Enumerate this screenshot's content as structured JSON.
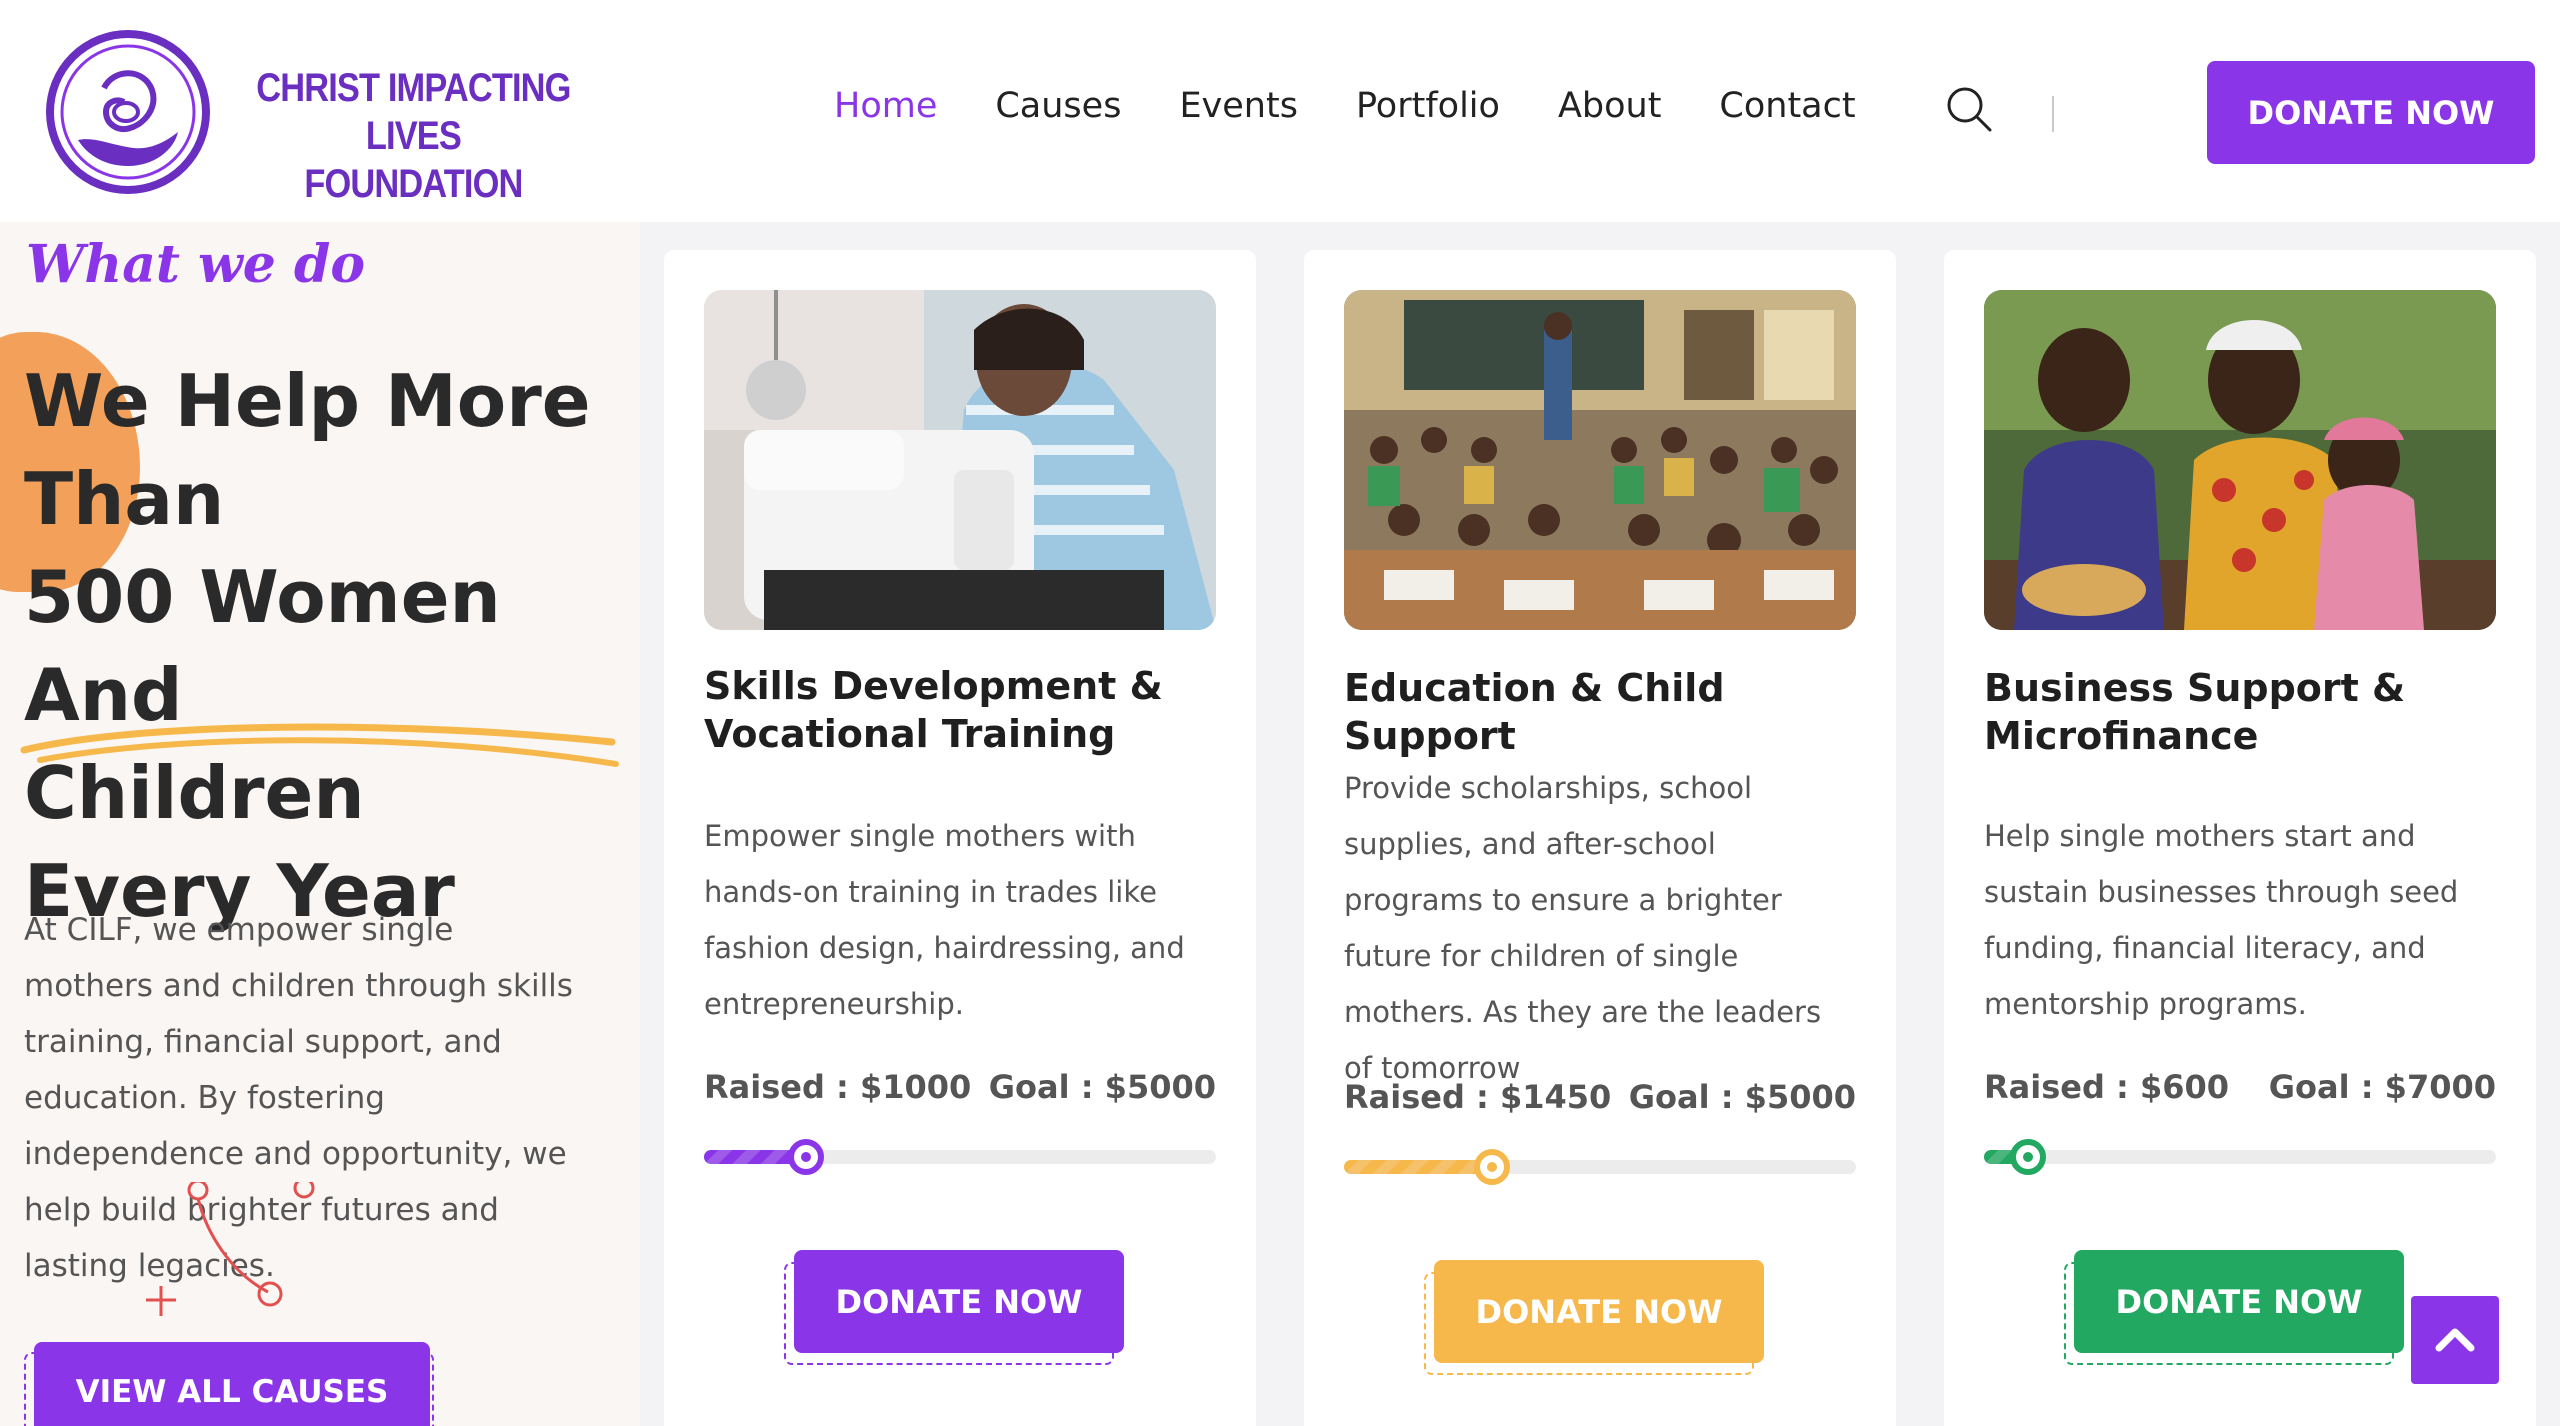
{
  "brand": {
    "name_line1": "CHRIST IMPACTING LIVES",
    "name_line2": "FOUNDATION",
    "color": "#6a2fc0"
  },
  "nav": {
    "items": [
      "Home",
      "Causes",
      "Events",
      "Portfolio",
      "About",
      "Contact"
    ],
    "active": "Home",
    "search_icon": "search-icon"
  },
  "header": {
    "donate_label": "DONATE NOW"
  },
  "hero": {
    "tagline": "What we do",
    "headline_lines": [
      "We Help More",
      "Than",
      "500 Women And",
      "Children",
      "Every Year"
    ],
    "intro": "At CILF, we empower single mothers and children through skills training, financial support, and education. By fostering independence and opportunity, we help build brighter futures and lasting legacies.",
    "view_all_label": "VIEW ALL CAUSES"
  },
  "causes": [
    {
      "title": "Skills Development & Vocational Training",
      "description": "Empower single mothers with hands-on training in trades like fashion design, hairdressing, and entrepreneurship.",
      "raised_label": "Raised : $1000",
      "goal_label": "Goal : $5000",
      "progress": 0.2,
      "accent": "#8a35e8",
      "donate_label": "DONATE NOW",
      "image": "woman-sewing-machine-image"
    },
    {
      "title": "Education & Child Support",
      "description": "Provide scholarships, school supplies, and after-school programs to ensure a brighter future for children of single mothers. As they are the leaders of tomorrow",
      "raised_label": "Raised : $1450",
      "goal_label": "Goal : $5000",
      "progress": 0.29,
      "accent": "#f7b84b",
      "donate_label": "DONATE NOW",
      "image": "classroom-children-image"
    },
    {
      "title": "Business Support & Microfinance",
      "description": "Help single mothers start and sustain businesses through seed funding, financial literacy, and mentorship programs.",
      "raised_label": "Raised : $600",
      "goal_label": "Goal : $7000",
      "progress": 0.086,
      "accent": "#22a861",
      "donate_label": "DONATE NOW",
      "image": "women-with-baby-image"
    }
  ],
  "colors": {
    "primary": "#8a35e8",
    "orange": "#f2a05a",
    "yellow": "#f7b84b",
    "green": "#22a861"
  }
}
